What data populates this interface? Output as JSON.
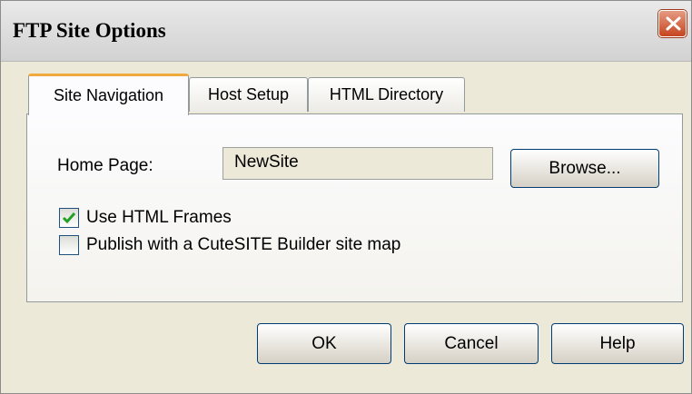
{
  "window": {
    "title": "FTP Site Options",
    "close_icon": "close-icon",
    "accent": "#c6451f"
  },
  "tabs": [
    {
      "label": "Site Navigation",
      "active": true
    },
    {
      "label": "Host Setup",
      "active": false
    },
    {
      "label": "HTML Directory",
      "active": false
    }
  ],
  "site_navigation": {
    "home_page_label": "Home Page:",
    "home_page_value": "NewSite",
    "browse_label": "Browse...",
    "use_frames_label": "Use HTML Frames",
    "use_frames_checked": true,
    "publish_sitemap_label": "Publish with a CuteSITE Builder site map",
    "publish_sitemap_checked": false
  },
  "footer": {
    "ok_label": "OK",
    "cancel_label": "Cancel",
    "help_label": "Help"
  }
}
